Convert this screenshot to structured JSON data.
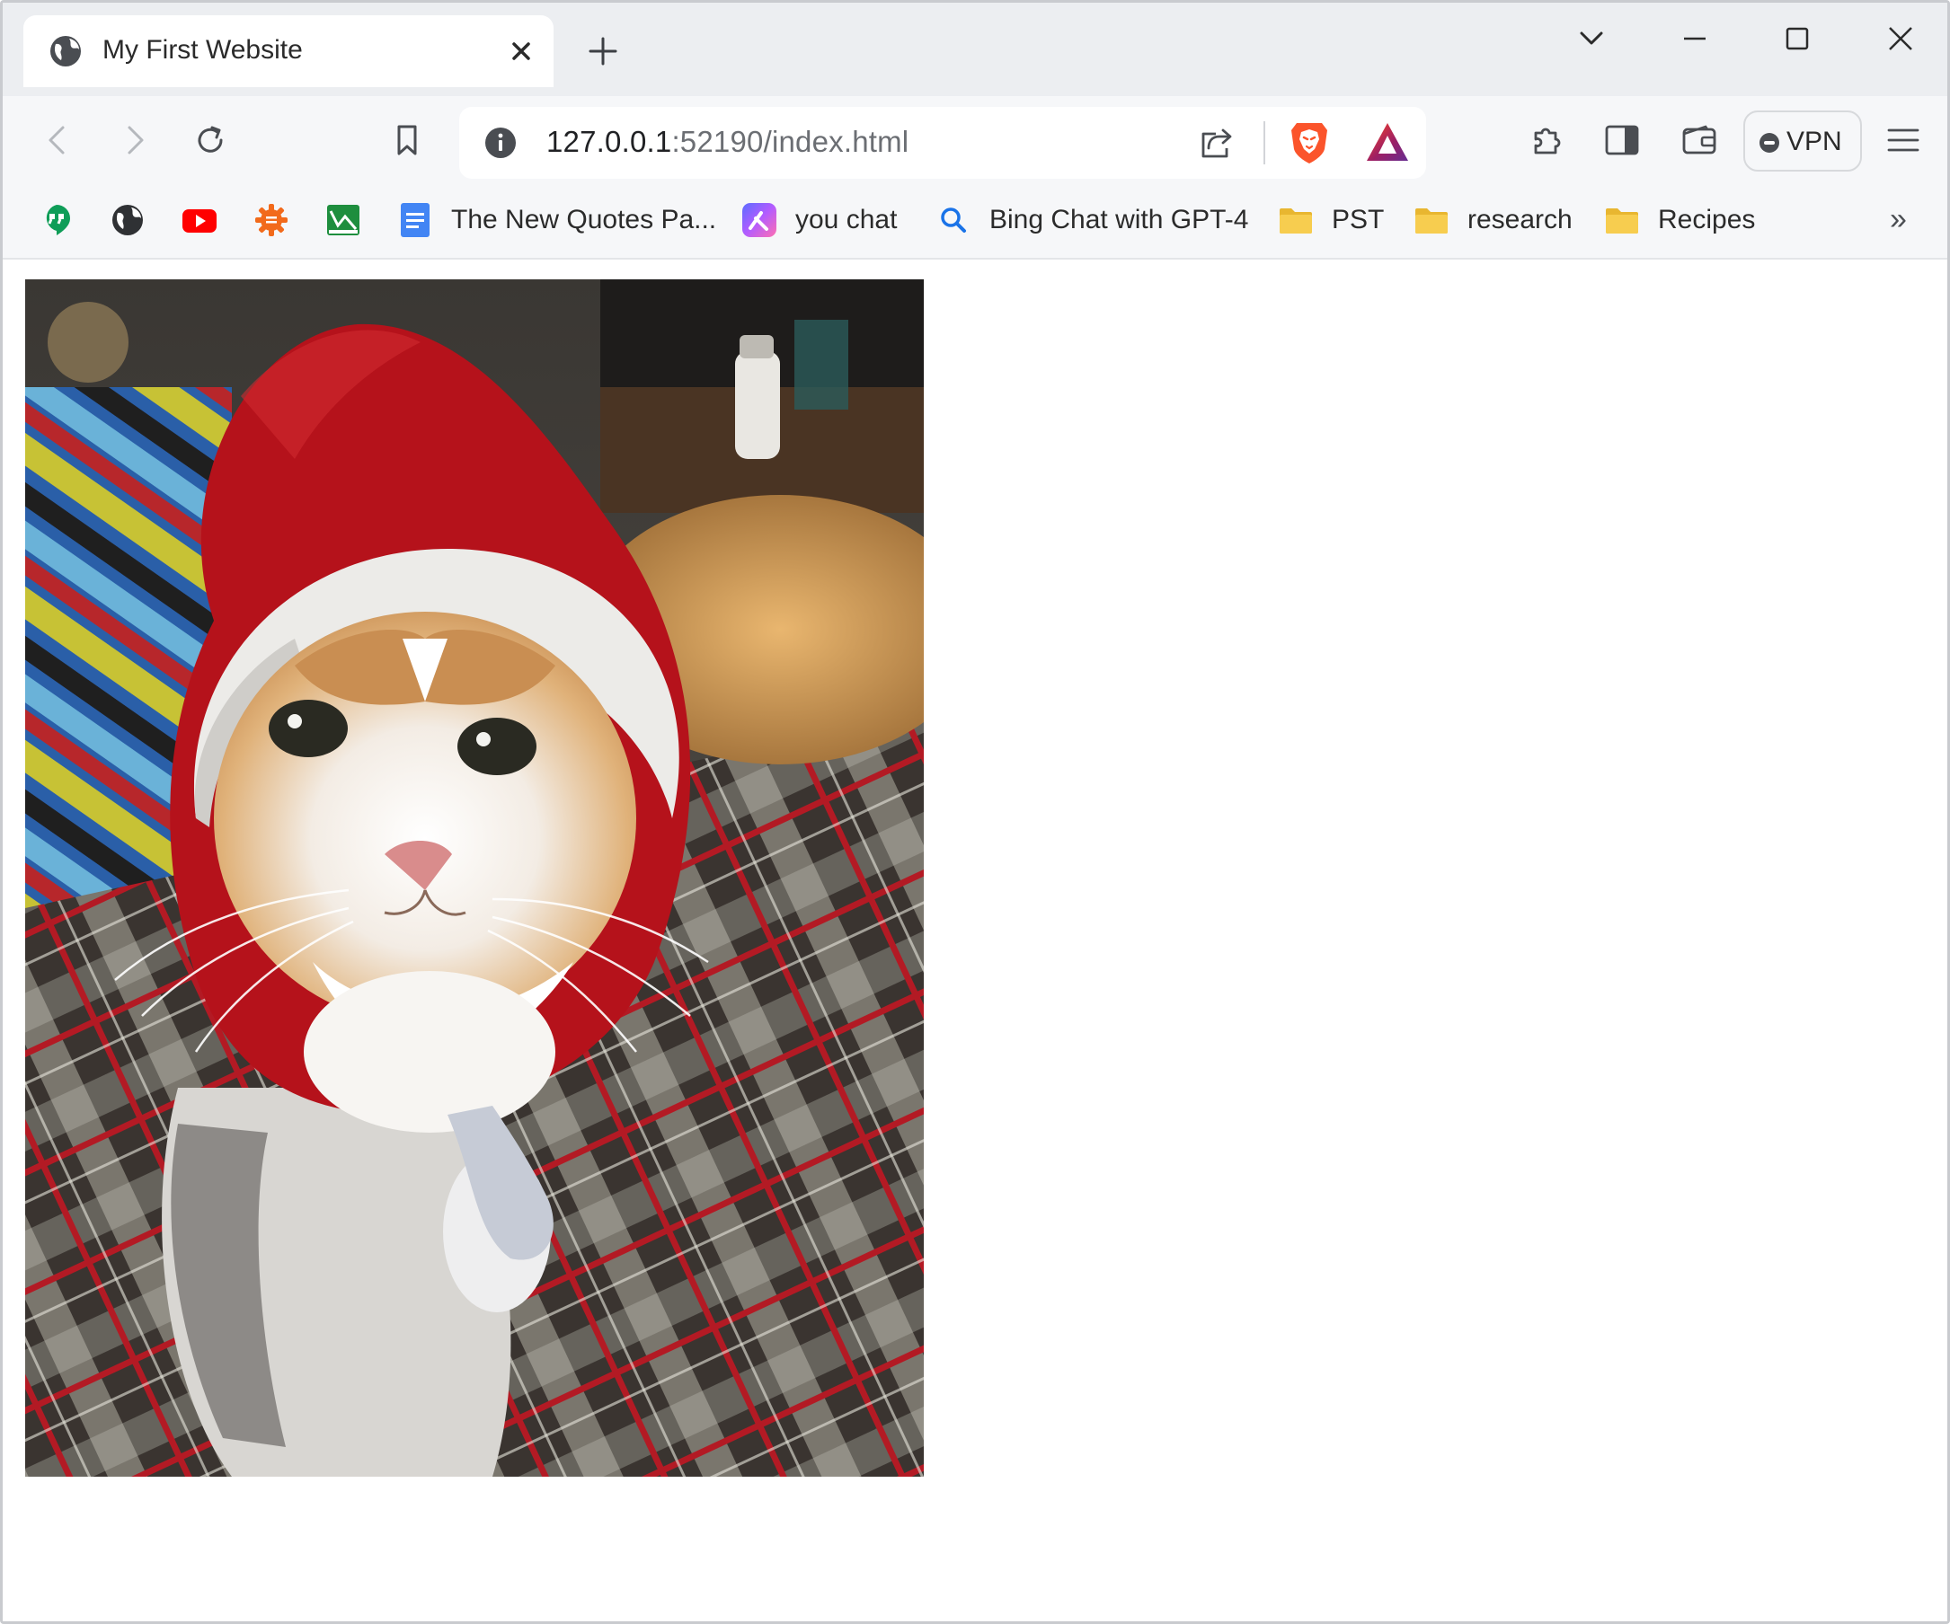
{
  "browser": {
    "tab": {
      "title": "My First Website",
      "favicon": "globe-icon"
    },
    "window_controls": [
      "tab-search-chevron-icon",
      "minimize-icon",
      "maximize-icon",
      "close-icon"
    ],
    "address_bar": {
      "url_host": "127.0.0.1",
      "url_rest": ":52190/index.html"
    },
    "vpn_label": "VPN",
    "colors": {
      "tab_strip": "#eceef1",
      "toolbar": "#f6f7f9",
      "brave_orange": "#fb542b"
    }
  },
  "bookmarks": [
    {
      "label": "",
      "icon": "hangouts-icon"
    },
    {
      "label": "",
      "icon": "globe-icon"
    },
    {
      "label": "",
      "icon": "youtube-icon"
    },
    {
      "label": "",
      "icon": "orange-gear-icon"
    },
    {
      "label": "",
      "icon": "green-chart-icon"
    },
    {
      "label": "The New Quotes Pa...",
      "icon": "google-docs-icon"
    },
    {
      "label": "you chat",
      "icon": "you-chat-icon"
    },
    {
      "label": "Bing Chat with GPT-4",
      "icon": "search-icon"
    },
    {
      "label": "PST",
      "icon": "folder-icon"
    },
    {
      "label": "research",
      "icon": "folder-icon"
    },
    {
      "label": "Recipes",
      "icon": "folder-icon"
    }
  ],
  "page": {
    "image": {
      "subject": "calico-cat-in-santa-hood-photo"
    }
  }
}
